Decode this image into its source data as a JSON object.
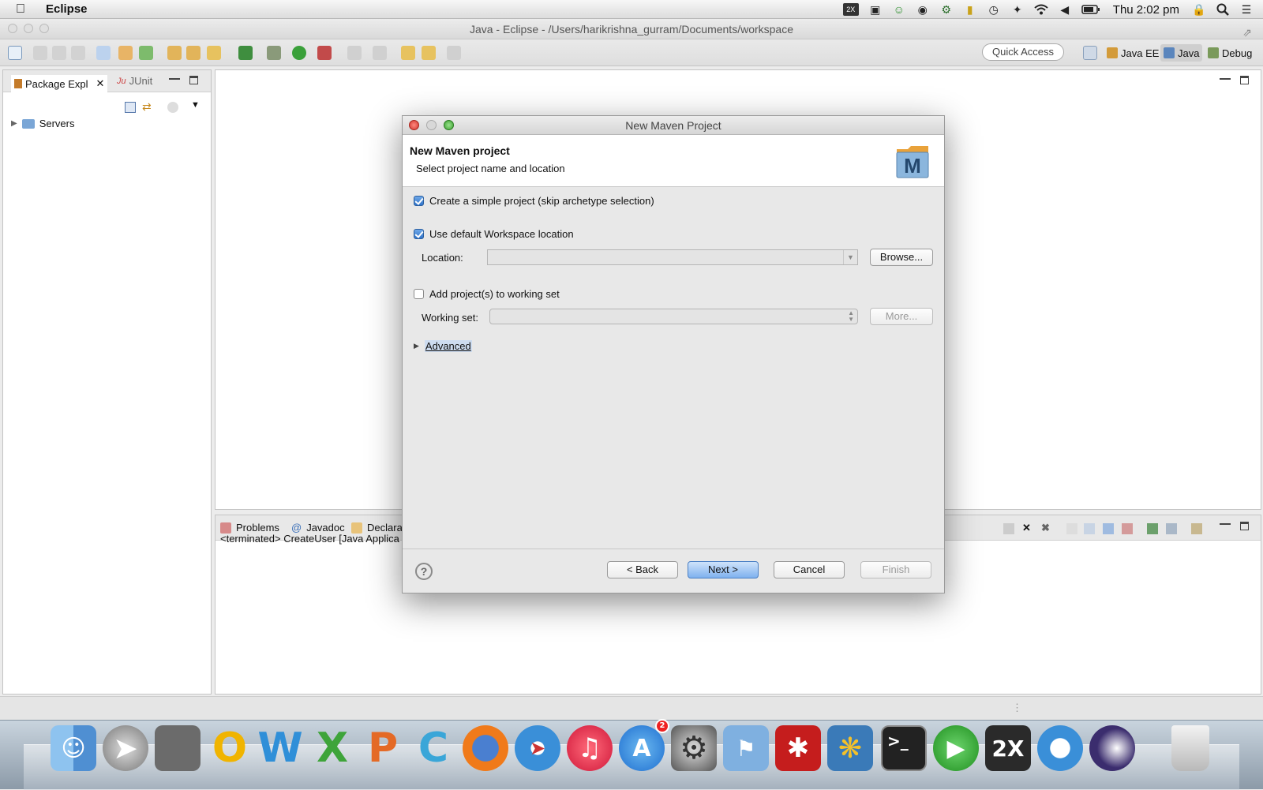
{
  "menubar": {
    "app_name": "Eclipse",
    "clock": "Thu 2:02 pm",
    "status_icons": [
      "2x-icon",
      "clipboard-icon",
      "smile-icon",
      "circle-icon",
      "gear-icon",
      "shield-icon",
      "time-machine-icon",
      "bluetooth-icon",
      "wifi-icon",
      "volume-icon",
      "battery-icon",
      "lock-icon",
      "search-icon",
      "list-icon"
    ]
  },
  "window": {
    "title": "Java - Eclipse - /Users/harikrishna_gurram/Documents/workspace"
  },
  "toolbar": {
    "quick_access": "Quick Access",
    "perspectives": [
      {
        "label": "Java EE",
        "icon": "java-ee-perspective-icon"
      },
      {
        "label": "Java",
        "icon": "java-perspective-icon",
        "active": true
      },
      {
        "label": "Debug",
        "icon": "debug-perspective-icon"
      }
    ]
  },
  "left_panel": {
    "tabs": [
      "Package Expl",
      "JUnit"
    ],
    "tree": [
      {
        "label": "Servers"
      }
    ]
  },
  "console": {
    "tabs": [
      "Problems",
      "Javadoc",
      "Declara"
    ],
    "content": "<terminated> CreateUser [Java Applica"
  },
  "dialog": {
    "title": "New Maven Project",
    "heading": "New Maven project",
    "subheading": "Select project name and location",
    "simple_project": {
      "label": "Create a simple project (skip archetype selection)",
      "checked": true
    },
    "default_workspace": {
      "label": "Use default Workspace location",
      "checked": true
    },
    "location_label": "Location:",
    "location_value": "",
    "browse": "Browse...",
    "working_set_check": {
      "label": "Add project(s) to working set",
      "checked": false
    },
    "working_set_label": "Working set:",
    "working_set_value": "",
    "more": "More...",
    "advanced": "Advanced",
    "buttons": {
      "back": "< Back",
      "next": "Next >",
      "cancel": "Cancel",
      "finish": "Finish"
    }
  },
  "dock": {
    "apps": [
      "finder",
      "launchpad",
      "photo-browser",
      "openoffice",
      "word",
      "excel",
      "powerpoint",
      "c-app",
      "firefox",
      "safari",
      "itunes",
      "app-store",
      "system-preferences",
      "network",
      "acrobat",
      "dictionary",
      "terminal",
      "play",
      "2x",
      "messages",
      "eclipse",
      "trash"
    ],
    "app_store_badge": "2"
  },
  "colors": {
    "accent": "#3a7bd5",
    "dialog_bg": "#e8e8e8"
  }
}
